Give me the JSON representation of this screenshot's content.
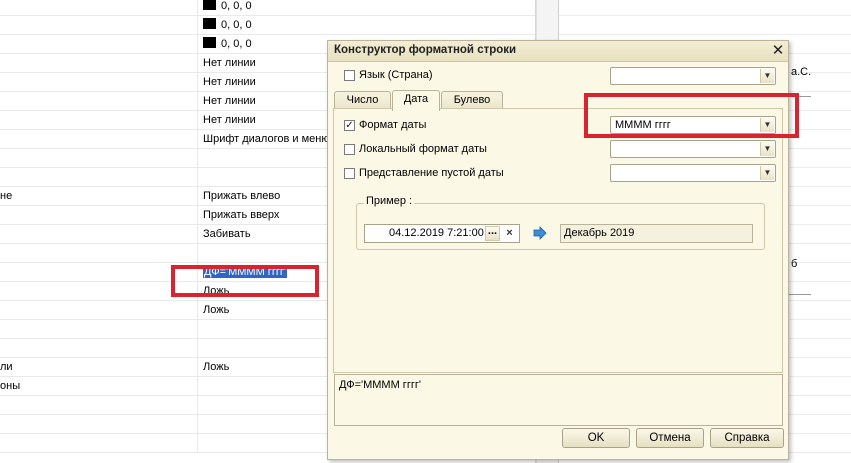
{
  "grid": {
    "rows": [
      {
        "left": "",
        "right": "0, 0, 0",
        "swatch": true
      },
      {
        "left": "",
        "right": "0, 0, 0",
        "swatch": true
      },
      {
        "left": "",
        "right": "0, 0, 0",
        "swatch": true
      },
      {
        "left": "",
        "right": "Нет линии",
        "swatch": false
      },
      {
        "left": "",
        "right": "Нет линии",
        "swatch": false
      },
      {
        "left": "",
        "right": "Нет линии",
        "swatch": false
      },
      {
        "left": "",
        "right": "Нет линии",
        "swatch": false
      },
      {
        "left": "",
        "right": "Шрифт диалогов и меню",
        "swatch": false
      },
      {
        "left": "",
        "right": "",
        "swatch": false
      },
      {
        "left": "",
        "right": "",
        "swatch": false
      },
      {
        "left": "не",
        "right": "Прижать влево",
        "swatch": false
      },
      {
        "left": "",
        "right": "Прижать вверх",
        "swatch": false
      },
      {
        "left": "",
        "right": "Забивать",
        "swatch": false
      },
      {
        "left": "",
        "right": "",
        "swatch": false
      },
      {
        "left": "",
        "right": "ДФ='ММММ гггг'",
        "swatch": false,
        "selected": true
      },
      {
        "left": "",
        "right": "Ложь",
        "swatch": false
      },
      {
        "left": "",
        "right": "Ложь",
        "swatch": false
      },
      {
        "left": "",
        "right": "",
        "swatch": false
      },
      {
        "left": "",
        "right": "",
        "swatch": false
      },
      {
        "left": "ли",
        "right": "Ложь",
        "swatch": false
      },
      {
        "left": "оны",
        "right": "",
        "swatch": false
      },
      {
        "left": "",
        "right": "",
        "swatch": false
      },
      {
        "left": "",
        "right": "",
        "swatch": false
      },
      {
        "left": "",
        "right": "",
        "swatch": false
      }
    ]
  },
  "right_panel": {
    "fragment_top": "а.С.",
    "fragment_mid": "б"
  },
  "dialog": {
    "title": "Конструктор форматной строки",
    "language_label": "Язык (Страна)",
    "language_value": "",
    "tabs": [
      {
        "label": "Число",
        "active": false
      },
      {
        "label": "Дата",
        "active": true
      },
      {
        "label": "Булево",
        "active": false
      }
    ],
    "date_format_label": "Формат даты",
    "date_format_checked": true,
    "date_format_value": "ММММ гггг",
    "local_format_label": "Локальный формат даты",
    "local_format_checked": false,
    "local_format_value": "",
    "empty_date_label": "Представление пустой даты",
    "empty_date_checked": false,
    "empty_date_value": "",
    "example_label": "Пример :",
    "example_date": "04.12.2019  7:21:00",
    "example_dots": "...",
    "example_clear": "×",
    "example_result": "Декабрь 2019",
    "format_string": "ДФ='ММММ гггг'",
    "ok_label": "OK",
    "cancel_label": "Отмена",
    "help_label": "Справка",
    "check_mark": "✓",
    "arrow_color": "#3a8fd6"
  },
  "annotation_color": "#d9232e"
}
